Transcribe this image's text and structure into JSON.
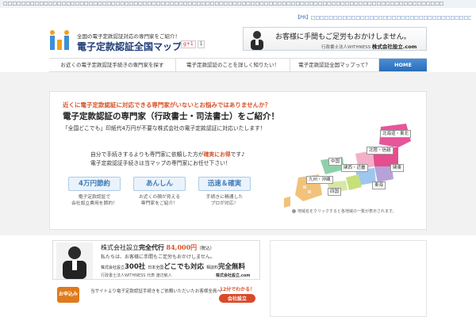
{
  "topline": {
    "text": "□□□□□□□□□□□□□□□□□□□□□□□□□□□□□□□□□□□□□□□□□□□□□□□□□□□□□□□□□□□□□□□□□□□□□□□□□□□□□□□□□□□□□□□□□□□□□□□□□□"
  },
  "pr": {
    "text": "【PR】□□□□□□□□□□□□□□□□□□□□□□□□□□□□□□□□□□□□□□□"
  },
  "header": {
    "tagline": "全国の電子定款認証対応の専門家をご紹介！",
    "site_title": "電子定款認証全国マップ",
    "gplus": "g+1",
    "gplus_count": "1",
    "banner_main": "お客様に手間もご足労もおかけしません。",
    "banner_firm": "行政書士法人WITHNESS",
    "banner_company": "株式会社設立.com"
  },
  "nav": {
    "items": [
      "お近くの電子定款認証手続きの専門家を探す",
      "電子定款認証のことを詳しく知りたい！",
      "電子定款認証全国マップって？",
      "HOME"
    ]
  },
  "hero": {
    "question": "近くに電子定款認証に対応できる専門家がいないとお悩みではありませんか？",
    "title": "電子定款認証の専門家（行政書士・司法書士）をご紹介！",
    "sub": "「全国どこでも」印紙代4万円が不要な株式会社の電子定款認証に対応いたします！",
    "line1_a": "自分で手続きするよりも専門家に依頼した方が",
    "line1_red": "確実にお得",
    "line1_b": "です♪",
    "line2": "電子定款認証手続きは当マップの専門家にお任せ下さい！",
    "features": [
      {
        "label": "4万円節約",
        "desc1": "電子定款認証で",
        "desc2": "会社設立費用を節約！"
      },
      {
        "label": "あんしん",
        "desc1": "お近くの顔が見える",
        "desc2": "専門家をご紹介！"
      },
      {
        "label": "迅速＆確実",
        "desc1": "手続きに精通した",
        "desc2": "プロが対応！"
      }
    ]
  },
  "map": {
    "regions": [
      "北海道・東北",
      "中国",
      "北陸・信越",
      "関西・近畿",
      "関東",
      "九州・沖縄",
      "四国",
      "東海"
    ],
    "caption": "地域名をクリックすると各地域の一覧が表示されます。"
  },
  "ad": {
    "a1": "株式会社設立",
    "a1_bold": "完全代行",
    "price": "84,000円",
    "tax": "（税込）",
    "a2": "私たちは、お客様に手間もご足労もおかけしません。",
    "a3_small1": "株式会社設立",
    "a3_big1": "300社",
    "a3_small2": "日本全国",
    "a3_big2": "どこでも対応",
    "a3_small3": "相談料",
    "a3_big3": "完全無料",
    "a4": "行政書士法人WITHNESS 代表 渡辺敏人",
    "logo": "株式会社設立.com"
  },
  "lower": {
    "badge": "お申込み",
    "text": "当サイトより電子定款認証手続きをご依頼いただいたお客様全員へ",
    "bubble1": "12分でわかる！",
    "bubble2": "会社設立"
  },
  "colors": {
    "accent": "#2a6cb8",
    "orange": "#d9542a"
  }
}
